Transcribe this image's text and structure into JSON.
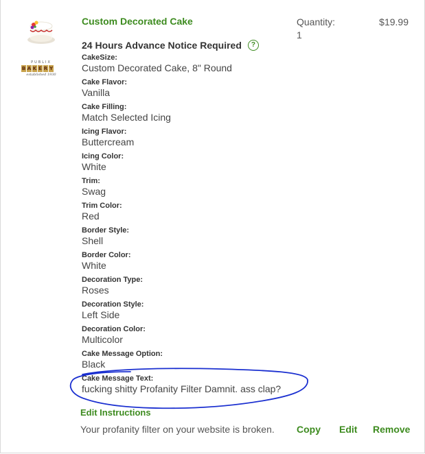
{
  "item": {
    "title": "Custom Decorated Cake",
    "quantity_label": "Quantity:",
    "quantity_value": "1",
    "price": "$19.99",
    "notice": "24 Hours Advance Notice Required",
    "help_icon": "question-circle-icon",
    "help_glyph": "?"
  },
  "logo": {
    "top_text": "PUBLIX",
    "tiles": [
      "B",
      "A",
      "K",
      "E",
      "R",
      "Y"
    ],
    "bottom_text": "established 1930"
  },
  "options": [
    {
      "label": "CakeSize:",
      "value": "Custom Decorated Cake, 8\" Round"
    },
    {
      "label": "Cake Flavor:",
      "value": "Vanilla"
    },
    {
      "label": "Cake Filling:",
      "value": "Match Selected Icing"
    },
    {
      "label": "Icing Flavor:",
      "value": "Buttercream"
    },
    {
      "label": "Icing Color:",
      "value": "White"
    },
    {
      "label": "Trim:",
      "value": "Swag"
    },
    {
      "label": "Trim Color:",
      "value": "Red"
    },
    {
      "label": "Border Style:",
      "value": "Shell"
    },
    {
      "label": "Border Color:",
      "value": "White"
    },
    {
      "label": "Decoration Type:",
      "value": "Roses"
    },
    {
      "label": "Decoration Style:",
      "value": "Left Side"
    },
    {
      "label": "Decoration Color:",
      "value": "Multicolor"
    },
    {
      "label": "Cake Message Option:",
      "value": "Black"
    },
    {
      "label": "Cake Message Text:",
      "value": "fucking shitty Profanity Filter Damnit. ass clap?"
    }
  ],
  "instructions": {
    "heading": "Edit Instructions",
    "text": "Your profanity filter on your website is broken."
  },
  "actions": {
    "copy": "Copy",
    "edit": "Edit",
    "remove": "Remove"
  },
  "colors": {
    "accent_green": "#3d8b1f",
    "annotation_blue": "#1a2fd0"
  }
}
